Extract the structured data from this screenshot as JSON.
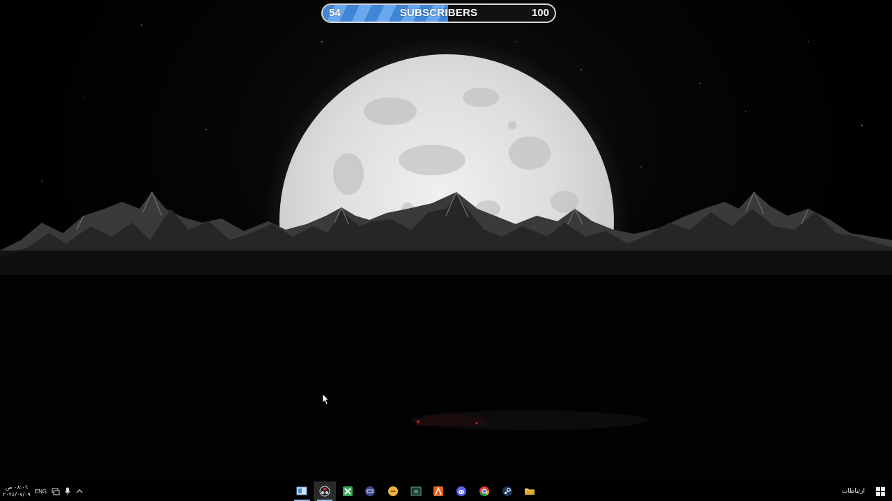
{
  "subscriber_widget": {
    "current": "54",
    "label": "SUBSCRIBERS",
    "goal": "100",
    "progress_fraction": 0.54,
    "accent": "#3f86d6"
  },
  "taskbar": {
    "clock": {
      "time": "٠٨:٠٦ ص",
      "date": "٢٠٢٤/٠٧/٠٩"
    },
    "language": "ENG",
    "tray_icons": [
      "network-icon",
      "microphone-icon",
      "chevron-up-icon"
    ],
    "apps": [
      {
        "name": "file-manager-icon",
        "running": true,
        "active": false
      },
      {
        "name": "obs-icon",
        "running": true,
        "active": true
      },
      {
        "name": "xbox-icon",
        "running": false,
        "active": false
      },
      {
        "name": "keyboard-app-icon",
        "running": false,
        "active": false
      },
      {
        "name": "messenger-icon",
        "running": false,
        "active": false
      },
      {
        "name": "terminal-icon",
        "running": false,
        "active": false
      },
      {
        "name": "affinity-icon",
        "running": false,
        "active": false
      },
      {
        "name": "discord-icon",
        "running": false,
        "active": false
      },
      {
        "name": "chrome-icon",
        "running": false,
        "active": false
      },
      {
        "name": "steam-icon",
        "running": false,
        "active": false
      },
      {
        "name": "file-explorer-icon",
        "running": false,
        "active": false
      }
    ],
    "connections_label": "ارتباطات",
    "start_icon": "windows-start-icon"
  },
  "wallpaper": {
    "scene": "moon-over-mountains",
    "colors": {
      "moon": "#e6e6e6",
      "mountain_front": "#2c2c2c",
      "mountain_back": "#1a1a1a"
    }
  }
}
